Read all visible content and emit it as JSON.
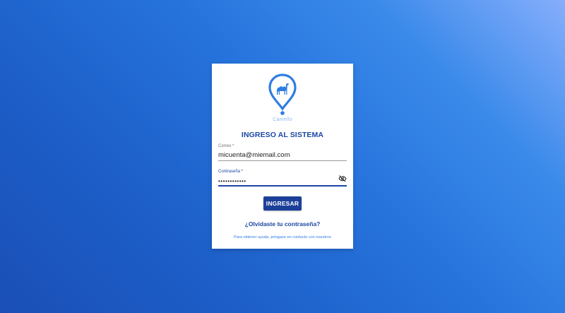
{
  "brand": {
    "logo_icon": "camel-location-pin-icon",
    "name": "Camello",
    "color": "#2f7de2"
  },
  "login": {
    "title": "INGRESO AL SISTEMA",
    "email": {
      "label": "Correo *",
      "value": "micuenta@miemail.com"
    },
    "password": {
      "label": "Contraseña *",
      "value": "••••••••••••",
      "toggle_icon": "eye-off-icon"
    },
    "submit_label": "INGRESAR",
    "forgot_label": "¿Olvidaste tu contraseña?",
    "help_text": "Para obtener ayuda, póngase en contacto con nosotros"
  },
  "colors": {
    "primary": "#1c3f99",
    "link": "#1c46a3",
    "background_start": "#86aefc",
    "background_end": "#1a4fb6"
  }
}
